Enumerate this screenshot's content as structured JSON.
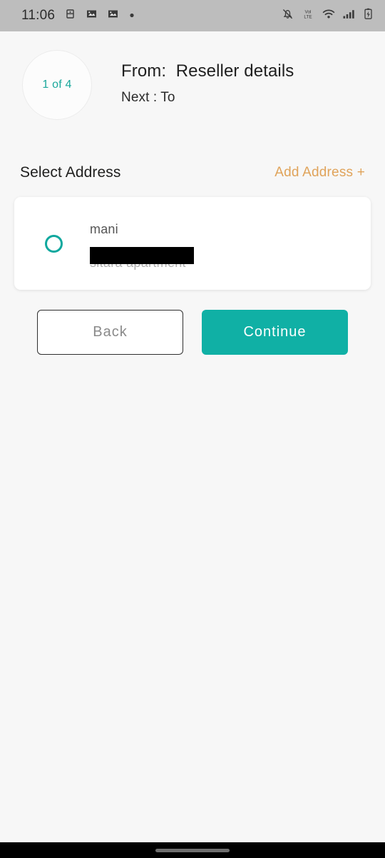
{
  "status_bar": {
    "time": "11:06",
    "left_icons": [
      "app-glyph-icon",
      "photo-badge-icon",
      "photo-badge-icon",
      "dot-icon"
    ],
    "right_icons": [
      "bell-off-icon",
      "volte-icon",
      "wifi-icon",
      "signal-bars-icon",
      "battery-icon"
    ],
    "volte_label_top": "Vol",
    "volte_label_bottom": "LTE",
    "background_color": "#bdbdbd"
  },
  "header": {
    "step_badge": "1 of 4",
    "from_line": "From:  Reseller details",
    "next_line": "Next : To",
    "step_color": "#1aa89c"
  },
  "section": {
    "title": "Select Address",
    "add_address_label": "Add Address +",
    "add_address_color": "#e0a35a"
  },
  "address_card": {
    "radio_state": "unselected",
    "radio_color": "#0fa89e",
    "name": "mani",
    "address_line": "sitara apartment",
    "redacted": true
  },
  "buttons": {
    "back_label": "Back",
    "continue_label": "Continue",
    "continue_color": "#10b0a5"
  },
  "nav_bar": {
    "gesture_pill": "home-gesture-pill"
  }
}
